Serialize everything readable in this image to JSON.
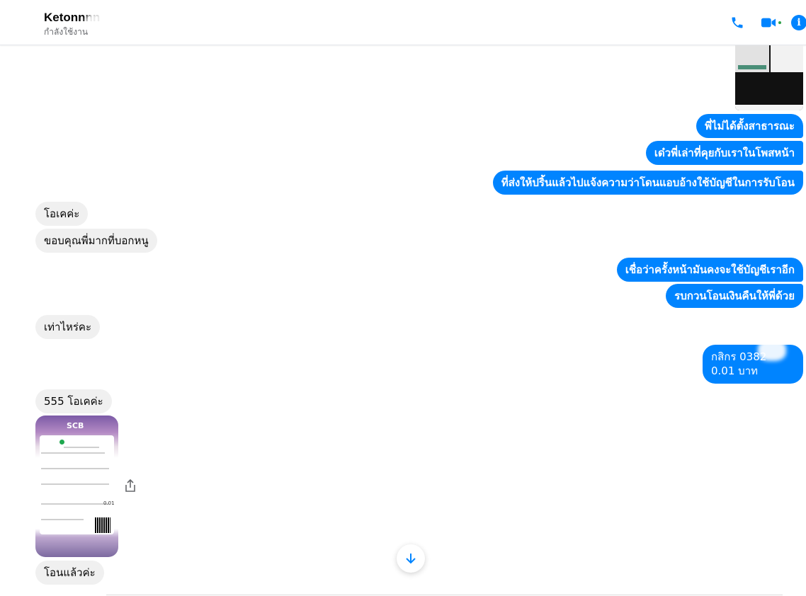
{
  "header": {
    "name": "Ketonnnn",
    "status": "กำลังใช้งาน",
    "colors": {
      "accent": "#0084ff",
      "online": "#31a24c"
    },
    "icons": [
      "phone-icon",
      "video-icon",
      "info-icon"
    ]
  },
  "messages": {
    "out_1": "พี่ไม่ได้ตั้งสาธารณะ",
    "out_2": "เด๋วพี่เล่าที่คุยกับเราในโพสหน้า",
    "out_3": "ที่ส่งให้ปริ้นแล้วไปแจ้งความว่าโดนแอบอ้างใช้บัญชีในการรับโอน",
    "in_1": "โอเคค่ะ",
    "in_2": "ขอบคุณพี่มากที่บอกหนู",
    "out_4": "เชื่อว่าครั้งหน้ามันคงจะใช้บัญชีเราอีก",
    "out_5": "รบกวนโอนเงินคืนให้พี่ด้วย",
    "in_3": "เท่าไหร่คะ",
    "out_6_line1": "กสิกร 0382",
    "out_6_line2": "0.01 บาท",
    "in_4": "555 โอเคค่ะ",
    "in_5": "โอนแล้วค่ะ"
  },
  "slip": {
    "bank": "SCB",
    "amount": "0.01"
  }
}
